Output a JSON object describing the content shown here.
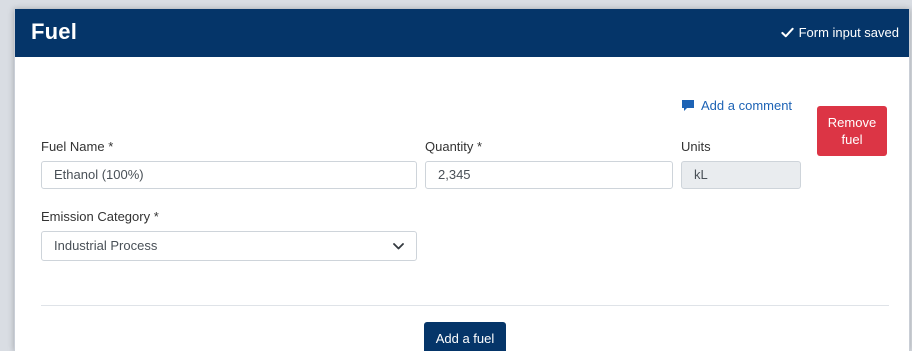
{
  "header": {
    "title": "Fuel",
    "status_text": "Form input saved"
  },
  "actions": {
    "add_comment": "Add a comment",
    "remove_line1": "Remove",
    "remove_line2": "fuel",
    "add_fuel": "Add a fuel"
  },
  "form": {
    "fuel_name": {
      "label": "Fuel Name *",
      "value": "Ethanol (100%)"
    },
    "quantity": {
      "label": "Quantity *",
      "value": "2,345"
    },
    "units": {
      "label": "Units",
      "value": "kL"
    },
    "emission_category": {
      "label": "Emission Category *",
      "value": "Industrial Process"
    }
  },
  "colors": {
    "header_bg": "#053569",
    "remove_btn": "#dc3545",
    "link": "#1d63b5"
  },
  "icons": {
    "status": "check-icon",
    "comment": "comment-icon",
    "select": "chevron-down-icon"
  }
}
